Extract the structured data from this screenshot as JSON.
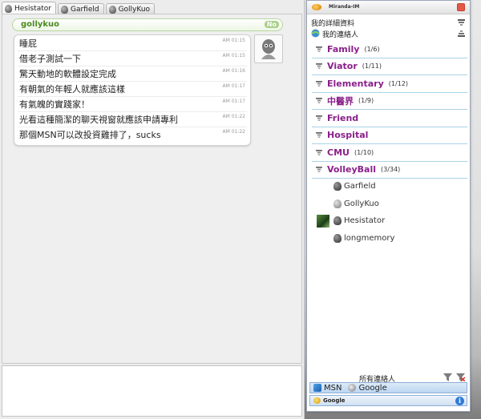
{
  "chat": {
    "tabs": [
      {
        "label": "Hesistator",
        "active": true
      },
      {
        "label": "Garfield",
        "active": false
      },
      {
        "label": "GollyKuo",
        "active": false
      }
    ],
    "nick": "gollykuo",
    "nick_badge": "No",
    "messages": [
      {
        "text": "睡屁",
        "time": "AM 01:15"
      },
      {
        "text": "借老子測試一下",
        "time": "AM 01:15"
      },
      {
        "text": "驚天動地的軟體設定完成",
        "time": "AM 01:16"
      },
      {
        "text": "有朝氣的年輕人就應該這樣",
        "time": "AM 01:17"
      },
      {
        "text": "有氣魄的實踐家！",
        "time": "AM 01:17"
      },
      {
        "text": "光看這種簡潔的聊天視窗就應該申請專利",
        "time": "AM 01:22"
      },
      {
        "text": "那個MSN可以改投資雞排了，sucks",
        "time": "AM 01:22"
      }
    ]
  },
  "clist": {
    "title": "Miranda-IM",
    "my_details": "我的詳細資料",
    "my_contacts": "我的連絡人",
    "groups": [
      {
        "name": "Family",
        "count": "(1/6)"
      },
      {
        "name": "Viator",
        "count": "(1/11)"
      },
      {
        "name": "Elementary",
        "count": "(1/12)"
      },
      {
        "name": "中醫界",
        "count": "(1/9)"
      },
      {
        "name": "Friend",
        "count": ""
      },
      {
        "name": "Hospital",
        "count": ""
      },
      {
        "name": "CMU",
        "count": "(1/10)"
      },
      {
        "name": "VolleyBall",
        "count": "(3/34)"
      }
    ],
    "contacts": [
      {
        "name": "Garfield",
        "style": "dark",
        "avatar": false
      },
      {
        "name": "GollyKuo",
        "style": "light",
        "avatar": false
      },
      {
        "name": "Hesistator",
        "style": "dark",
        "avatar": true
      },
      {
        "name": "longmemory",
        "style": "dark",
        "avatar": false
      }
    ],
    "all_contacts_label": "所有連絡人",
    "status_items": [
      {
        "label": "MSN",
        "icon": "msn-icon"
      },
      {
        "label": "Google",
        "icon": "google-talk-icon"
      }
    ],
    "protocol_label": "Google",
    "info_glyph": "i"
  },
  "colors": {
    "group_name": "#8a1f8a",
    "nick": "#4a8a1e",
    "group_divider": "#a9d3e6"
  }
}
